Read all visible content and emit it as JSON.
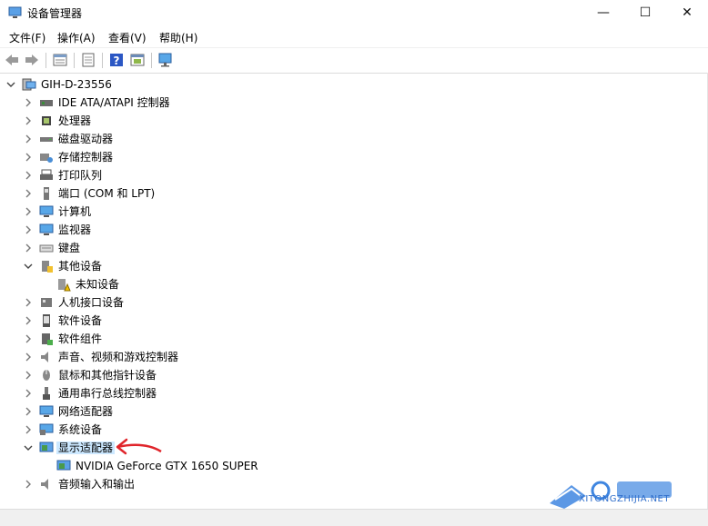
{
  "window": {
    "title": "设备管理器",
    "minimize_symbol": "—",
    "maximize_symbol": "☐",
    "close_symbol": "✕"
  },
  "menu": [
    "文件(F)",
    "操作(A)",
    "查看(V)",
    "帮助(H)"
  ],
  "toolbar": [
    {
      "name": "back-icon"
    },
    {
      "name": "forward-icon"
    },
    {
      "name": "properties-icon"
    },
    {
      "name": "update-driver-icon"
    },
    {
      "name": "help-icon"
    },
    {
      "name": "show-hidden-icon"
    },
    {
      "name": "scan-hardware-icon"
    }
  ],
  "tree": {
    "root": "GIH-D-23556",
    "items": [
      {
        "label": "IDE ATA/ATAPI 控制器",
        "icon": "ide-controller-icon",
        "state": "collapsed",
        "level": 1
      },
      {
        "label": "处理器",
        "icon": "processor-icon",
        "state": "collapsed",
        "level": 1
      },
      {
        "label": "磁盘驱动器",
        "icon": "disk-drive-icon",
        "state": "collapsed",
        "level": 1
      },
      {
        "label": "存储控制器",
        "icon": "storage-controller-icon",
        "state": "collapsed",
        "level": 1
      },
      {
        "label": "打印队列",
        "icon": "printer-icon",
        "state": "collapsed",
        "level": 1
      },
      {
        "label": "端口 (COM 和 LPT)",
        "icon": "port-icon",
        "state": "collapsed",
        "level": 1
      },
      {
        "label": "计算机",
        "icon": "computer-icon",
        "state": "collapsed",
        "level": 1
      },
      {
        "label": "监视器",
        "icon": "monitor-icon",
        "state": "collapsed",
        "level": 1
      },
      {
        "label": "键盘",
        "icon": "keyboard-icon",
        "state": "collapsed",
        "level": 1
      },
      {
        "label": "其他设备",
        "icon": "other-devices-icon",
        "state": "expanded",
        "level": 1
      },
      {
        "label": "未知设备",
        "icon": "unknown-device-warning-icon",
        "state": "leaf",
        "level": 2
      },
      {
        "label": "人机接口设备",
        "icon": "hid-icon",
        "state": "collapsed",
        "level": 1
      },
      {
        "label": "软件设备",
        "icon": "software-device-icon",
        "state": "collapsed",
        "level": 1
      },
      {
        "label": "软件组件",
        "icon": "software-component-icon",
        "state": "collapsed",
        "level": 1
      },
      {
        "label": "声音、视频和游戏控制器",
        "icon": "sound-icon",
        "state": "collapsed",
        "level": 1
      },
      {
        "label": "鼠标和其他指针设备",
        "icon": "mouse-icon",
        "state": "collapsed",
        "level": 1
      },
      {
        "label": "通用串行总线控制器",
        "icon": "usb-icon",
        "state": "collapsed",
        "level": 1
      },
      {
        "label": "网络适配器",
        "icon": "network-adapter-icon",
        "state": "collapsed",
        "level": 1
      },
      {
        "label": "系统设备",
        "icon": "system-device-icon",
        "state": "collapsed",
        "level": 1
      },
      {
        "label": "显示适配器",
        "icon": "display-adapter-icon",
        "state": "expanded",
        "level": 1,
        "selected": true
      },
      {
        "label": "NVIDIA GeForce GTX 1650 SUPER",
        "icon": "display-adapter-icon",
        "state": "leaf",
        "level": 2
      },
      {
        "label": "音频输入和输出",
        "icon": "audio-io-icon",
        "state": "collapsed",
        "level": 1
      }
    ]
  },
  "annotation": {
    "color": "#e0252b"
  },
  "watermark": {
    "text": "XITONGZHIJIA.NET",
    "color": "#2f6ecb"
  },
  "colors": {
    "selection": "#cce8ff",
    "accent": "#2f6ecb"
  }
}
